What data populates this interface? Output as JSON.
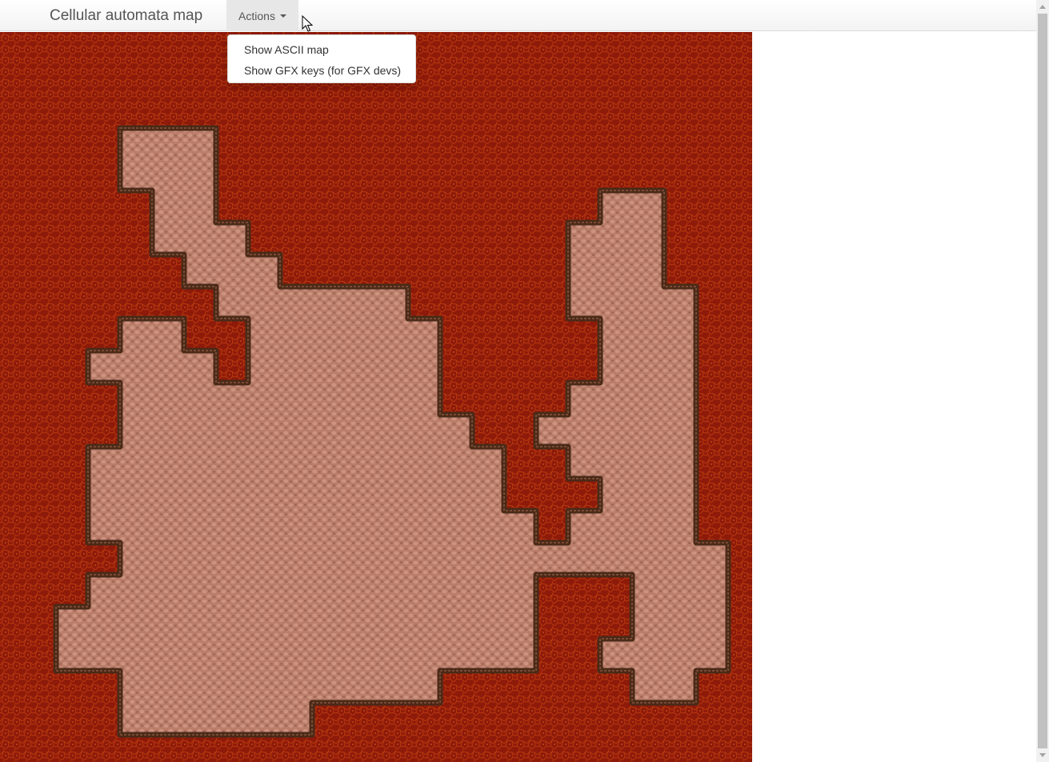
{
  "navbar": {
    "brand": "Cellular automata map",
    "actions_label": "Actions"
  },
  "actions_menu": {
    "items": [
      {
        "label": "Show ASCII map"
      },
      {
        "label": "Show GFX keys (for GFX devs)"
      }
    ]
  },
  "map": {
    "lava_color": "#8e1a0a",
    "floor_color": "#b97d6a",
    "wall_color": "#4a2a18"
  }
}
